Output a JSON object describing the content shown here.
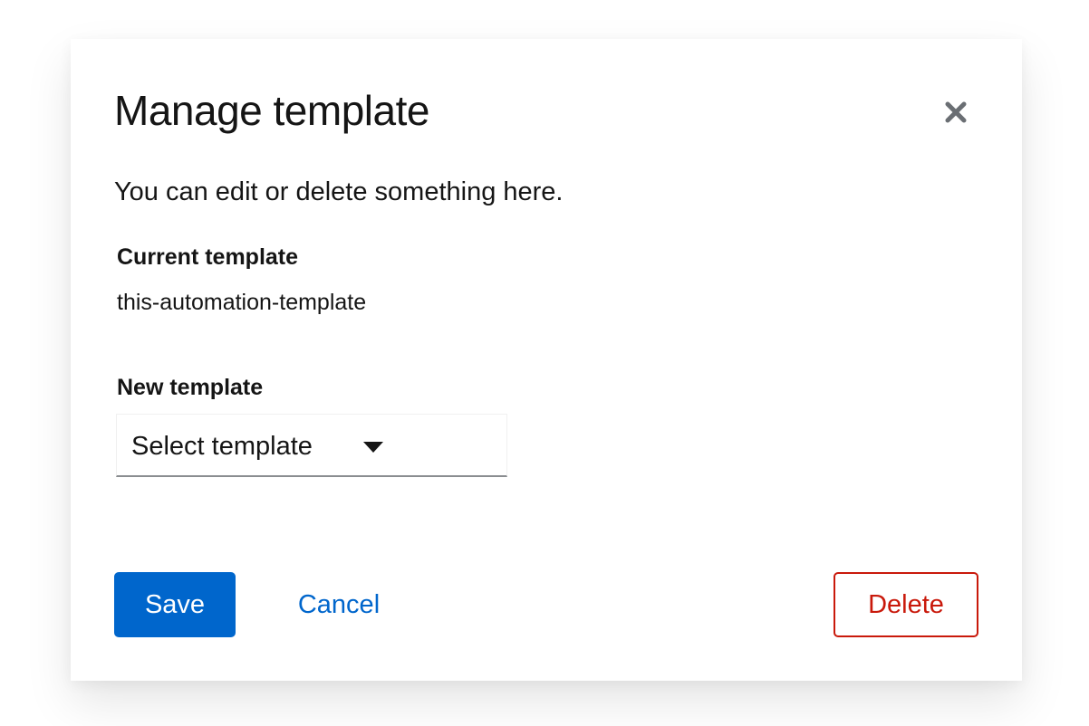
{
  "modal": {
    "title": "Manage template",
    "close_icon": "close-icon",
    "description": "You can edit or delete something here."
  },
  "current_template": {
    "label": "Current template",
    "value": "this-automation-template"
  },
  "new_template": {
    "label": "New template",
    "select_placeholder": "Select template",
    "caret_icon": "caret-down-icon"
  },
  "actions": {
    "save_label": "Save",
    "cancel_label": "Cancel",
    "delete_label": "Delete"
  },
  "colors": {
    "primary": "#0066cc",
    "danger": "#c9190b",
    "text": "#151515",
    "close_icon": "#6a6e73",
    "select_underline": "#8a8d90"
  }
}
